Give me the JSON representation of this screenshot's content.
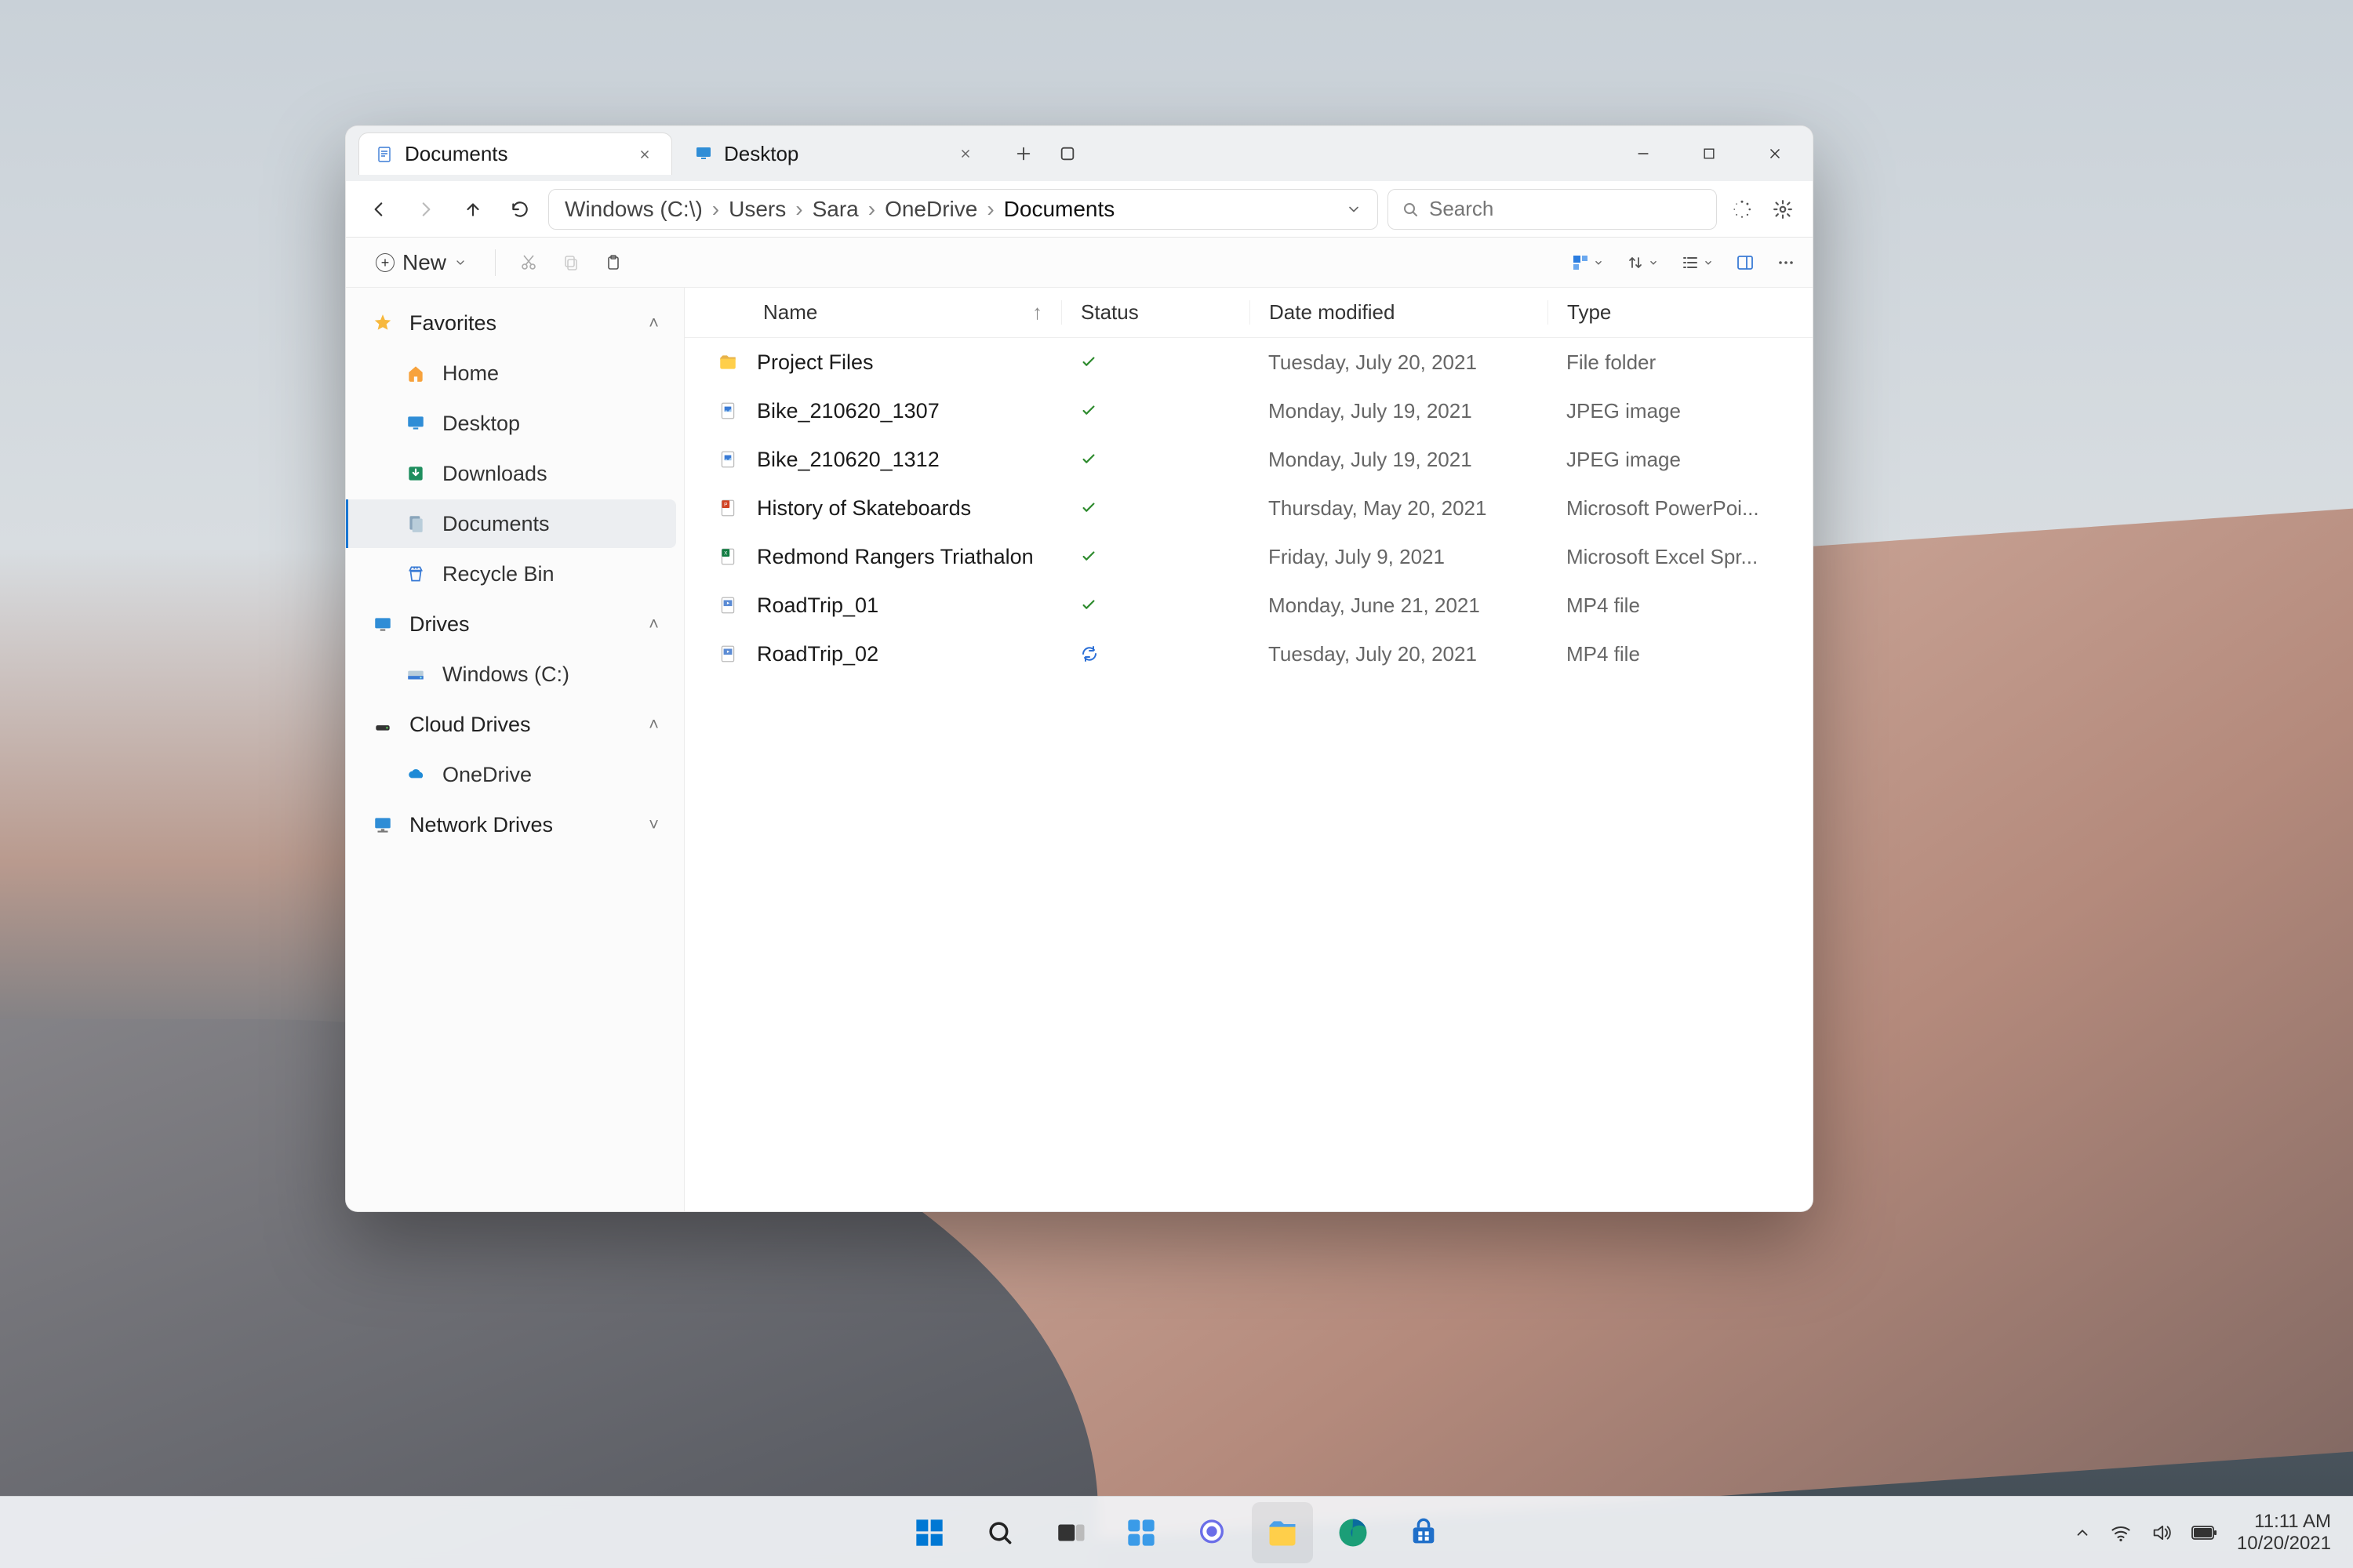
{
  "tabs": [
    {
      "label": "Documents",
      "icon": "doc",
      "active": true
    },
    {
      "label": "Desktop",
      "icon": "desktop",
      "active": false
    }
  ],
  "breadcrumbs": [
    "Windows (C:\\)",
    "Users",
    "Sara",
    "OneDrive",
    "Documents"
  ],
  "search_placeholder": "Search",
  "cmdbar": {
    "new_label": "New"
  },
  "columns": {
    "name": "Name",
    "status": "Status",
    "modified": "Date modified",
    "type": "Type"
  },
  "sidebar": [
    {
      "kind": "header",
      "icon": "star",
      "label": "Favorites",
      "chev": "up"
    },
    {
      "kind": "child",
      "icon": "home",
      "label": "Home"
    },
    {
      "kind": "child",
      "icon": "desktop",
      "label": "Desktop"
    },
    {
      "kind": "child",
      "icon": "downloads",
      "label": "Downloads"
    },
    {
      "kind": "child",
      "icon": "documents",
      "label": "Documents",
      "selected": true
    },
    {
      "kind": "child",
      "icon": "recycle",
      "label": "Recycle Bin"
    },
    {
      "kind": "header",
      "icon": "drive",
      "label": "Drives",
      "chev": "up"
    },
    {
      "kind": "child",
      "icon": "cdrive",
      "label": "Windows (C:)"
    },
    {
      "kind": "header",
      "icon": "cloud",
      "label": "Cloud Drives",
      "chev": "up"
    },
    {
      "kind": "child",
      "icon": "onedrive",
      "label": "OneDrive"
    },
    {
      "kind": "header",
      "icon": "network",
      "label": "Network Drives",
      "chev": "down"
    }
  ],
  "files": [
    {
      "icon": "folder",
      "name": "Project Files",
      "status": "check",
      "modified": "Tuesday, July 20, 2021",
      "type": "File folder"
    },
    {
      "icon": "jpg",
      "name": "Bike_210620_1307",
      "status": "check",
      "modified": "Monday, July 19, 2021",
      "type": "JPEG image"
    },
    {
      "icon": "jpg",
      "name": "Bike_210620_1312",
      "status": "check",
      "modified": "Monday, July 19, 2021",
      "type": "JPEG image"
    },
    {
      "icon": "ppt",
      "name": "History of Skateboards",
      "status": "check",
      "modified": "Thursday, May 20, 2021",
      "type": "Microsoft PowerPoi..."
    },
    {
      "icon": "xls",
      "name": "Redmond Rangers Triathalon",
      "status": "check",
      "modified": "Friday, July 9, 2021",
      "type": "Microsoft Excel Spr..."
    },
    {
      "icon": "mp4",
      "name": "RoadTrip_01",
      "status": "check",
      "modified": "Monday, June 21, 2021",
      "type": "MP4 file"
    },
    {
      "icon": "mp4",
      "name": "RoadTrip_02",
      "status": "sync",
      "modified": "Tuesday, July 20, 2021",
      "type": "MP4 file"
    }
  ],
  "tray": {
    "time": "11:11 AM",
    "date": "10/20/2021"
  }
}
